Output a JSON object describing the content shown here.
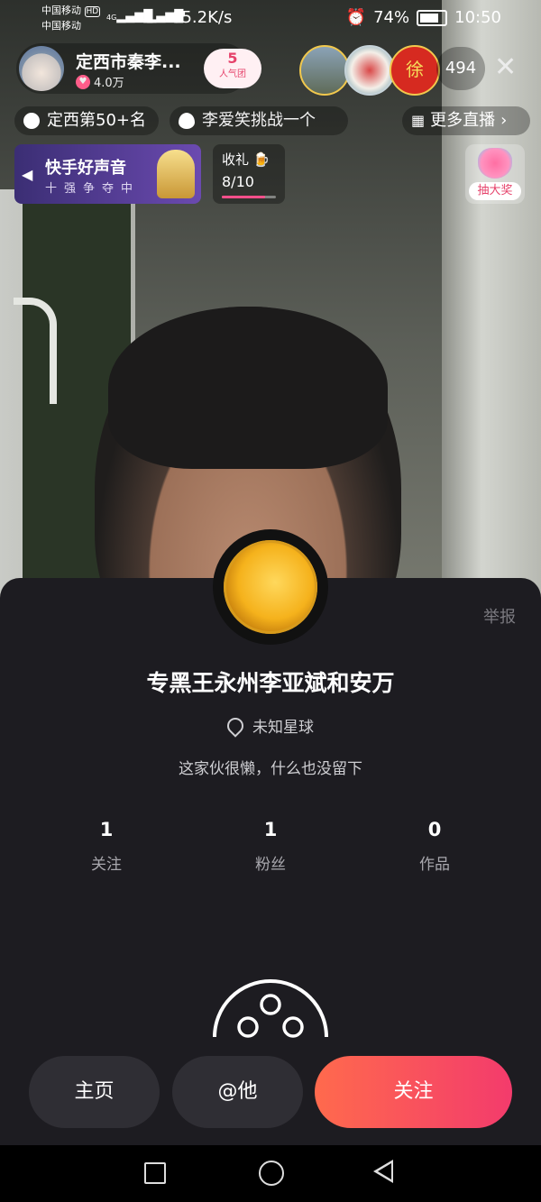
{
  "status_bar": {
    "carrier1": "中国移动",
    "carrier1_badge": "HD",
    "carrier2": "中国移动",
    "signal1": "4G",
    "signal2": "4G",
    "net_speed": "65.2K/s",
    "alarm_icon": "alarm-icon",
    "battery": "74%",
    "time": "10:50"
  },
  "live_header": {
    "anchor_name": "定西市秦李...",
    "anchor_likes": "4.0万",
    "fan_badge_level": "5",
    "fan_badge_label": "人气团",
    "viewer_avatar3_glyph": "徐",
    "viewer_count": "494",
    "close_glyph": "✕"
  },
  "chips": {
    "rank": "定西第50+名",
    "challenge": "李爱笑挑战一个",
    "more_live": "更多直播",
    "more_arrow": "›"
  },
  "banner": {
    "title": "快手好声音",
    "subtitle": "十强争夺中",
    "arrow": "◀"
  },
  "gift_task": {
    "label": "收礼",
    "progress_text": "8/10",
    "progress_fraction": 0.8
  },
  "lottery": {
    "label": "抽大奖"
  },
  "profile_card": {
    "report": "举报",
    "username": "专黑王永州李亚斌和安万",
    "location": "未知星球",
    "bio": "这家伙很懒，什么也没留下",
    "stats": [
      {
        "value": "1",
        "label": "关注"
      },
      {
        "value": "1",
        "label": "粉丝"
      },
      {
        "value": "0",
        "label": "作品"
      }
    ],
    "buttons": {
      "home": "主页",
      "at": "@他",
      "follow": "关注"
    }
  },
  "colors": {
    "card_bg": "#1d1c21",
    "follow_gradient_start": "#ff6a4d",
    "follow_gradient_end": "#f33b6c",
    "secondary_button": "#2f2e34"
  }
}
